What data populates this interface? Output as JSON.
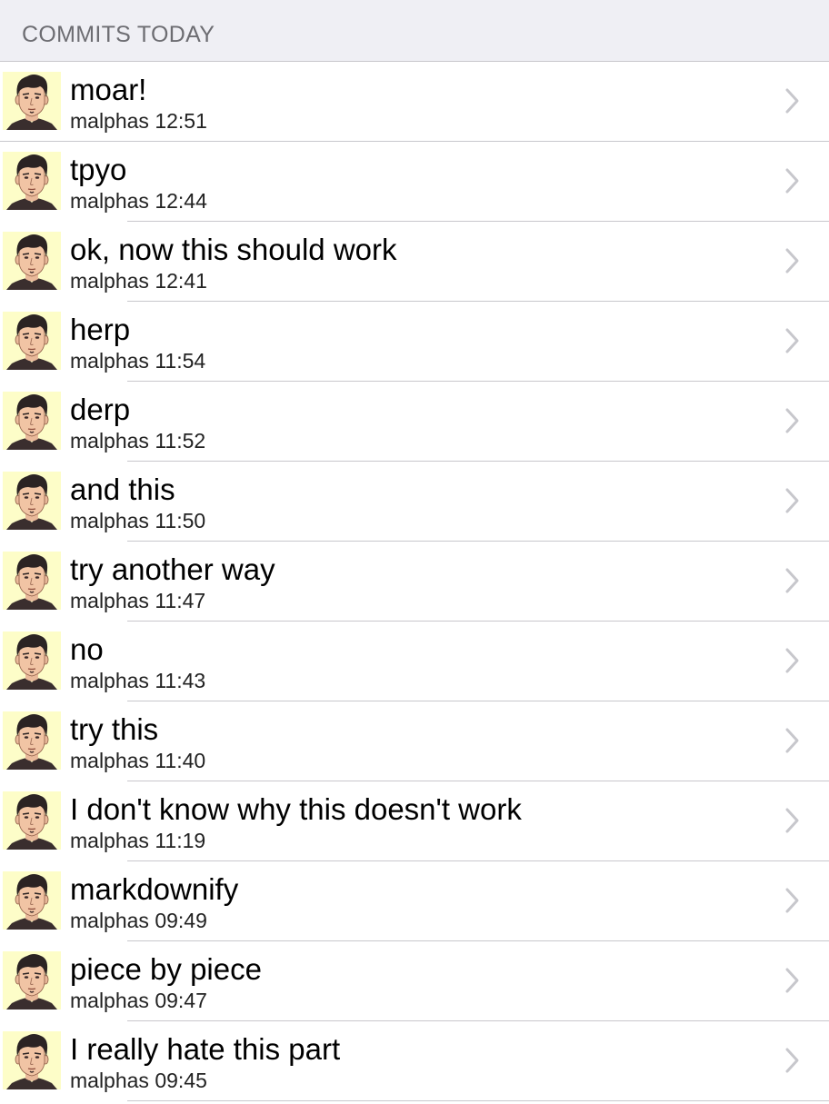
{
  "header": {
    "title": "COMMITS TODAY"
  },
  "commits": [
    {
      "message": "moar!",
      "meta": "malphas 12:51"
    },
    {
      "message": "tpyo",
      "meta": "malphas 12:44"
    },
    {
      "message": "ok, now this should work",
      "meta": "malphas 12:41"
    },
    {
      "message": "herp",
      "meta": "malphas 11:54"
    },
    {
      "message": "derp",
      "meta": "malphas 11:52"
    },
    {
      "message": "and this",
      "meta": "malphas 11:50"
    },
    {
      "message": "try another way",
      "meta": "malphas 11:47"
    },
    {
      "message": "no",
      "meta": "malphas 11:43"
    },
    {
      "message": "try this",
      "meta": "malphas 11:40"
    },
    {
      "message": "I don't know why this doesn't work",
      "meta": "malphas 11:19"
    },
    {
      "message": "markdownify",
      "meta": "malphas 09:49"
    },
    {
      "message": "piece by piece",
      "meta": "malphas 09:47"
    },
    {
      "message": "I really hate this part",
      "meta": "malphas 09:45"
    }
  ],
  "icons": {
    "avatar": "avatar-icon",
    "chevron": "chevron-right-icon"
  },
  "colors": {
    "header_bg": "#efeff4",
    "avatar_bg": "#fdfdc8",
    "separator": "#c8c7cc",
    "chevron": "#c7c7cc"
  }
}
